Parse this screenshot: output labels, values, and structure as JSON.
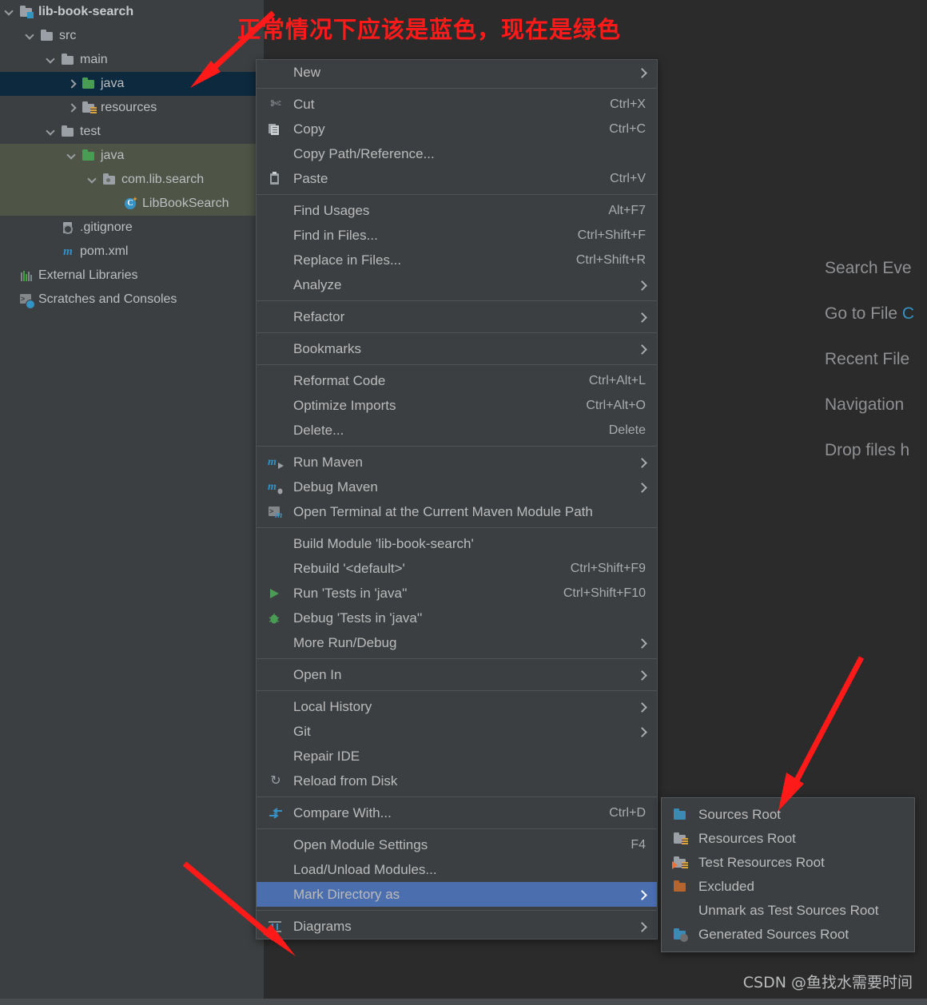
{
  "editor": {
    "hints": [
      {
        "label": "Search Eve",
        "key": ""
      },
      {
        "label": "Go to File",
        "key": "C"
      },
      {
        "label": "Recent File",
        "key": ""
      },
      {
        "label": "Navigation",
        "key": ""
      },
      {
        "label": "Drop files h",
        "key": ""
      }
    ]
  },
  "project_tree": {
    "items": [
      {
        "label": "lib-book-search",
        "indent": 0,
        "arrow": "down",
        "icon": "module-folder-icon",
        "bold": true,
        "state": "none"
      },
      {
        "label": "src",
        "indent": 1,
        "arrow": "down",
        "icon": "folder-gray-icon",
        "bold": false,
        "state": "none"
      },
      {
        "label": "main",
        "indent": 2,
        "arrow": "down",
        "icon": "folder-gray-icon",
        "bold": false,
        "state": "none"
      },
      {
        "label": "java",
        "indent": 3,
        "arrow": "right",
        "icon": "folder-green-icon",
        "bold": false,
        "state": "selected-blue"
      },
      {
        "label": "resources",
        "indent": 3,
        "arrow": "right",
        "icon": "folder-resources-icon",
        "bold": false,
        "state": "none"
      },
      {
        "label": "test",
        "indent": 2,
        "arrow": "down",
        "icon": "folder-gray-icon",
        "bold": false,
        "state": "none"
      },
      {
        "label": "java",
        "indent": 3,
        "arrow": "down",
        "icon": "folder-green-icon",
        "bold": false,
        "state": "selected-green"
      },
      {
        "label": "com.lib.search",
        "indent": 4,
        "arrow": "down",
        "icon": "package-icon",
        "bold": false,
        "state": "selected-green"
      },
      {
        "label": "LibBookSearch",
        "indent": 5,
        "arrow": "none",
        "icon": "java-class-icon",
        "bold": false,
        "state": "selected-green"
      },
      {
        "label": ".gitignore",
        "indent": 2,
        "arrow": "none",
        "icon": "gitignore-file-icon",
        "bold": false,
        "state": "none"
      },
      {
        "label": "pom.xml",
        "indent": 2,
        "arrow": "none",
        "icon": "maven-pom-icon",
        "bold": false,
        "state": "none"
      },
      {
        "label": "External Libraries",
        "indent": 0,
        "arrow": "none",
        "icon": "libraries-icon",
        "bold": false,
        "state": "none"
      },
      {
        "label": "Scratches and Consoles",
        "indent": 0,
        "arrow": "none",
        "icon": "scratches-icon",
        "bold": false,
        "state": "none"
      }
    ]
  },
  "context_menu": {
    "items": [
      {
        "type": "item",
        "label": "New",
        "shortcut": "",
        "icon": "",
        "arrow": true,
        "highlight": false
      },
      {
        "type": "separator"
      },
      {
        "type": "item",
        "label": "Cut",
        "shortcut": "Ctrl+X",
        "icon": "cut-icon",
        "arrow": false,
        "highlight": false
      },
      {
        "type": "item",
        "label": "Copy",
        "shortcut": "Ctrl+C",
        "icon": "copy-icon",
        "arrow": false,
        "highlight": false
      },
      {
        "type": "item",
        "label": "Copy Path/Reference...",
        "shortcut": "",
        "icon": "",
        "arrow": false,
        "highlight": false
      },
      {
        "type": "item",
        "label": "Paste",
        "shortcut": "Ctrl+V",
        "icon": "paste-icon",
        "arrow": false,
        "highlight": false
      },
      {
        "type": "separator"
      },
      {
        "type": "item",
        "label": "Find Usages",
        "shortcut": "Alt+F7",
        "icon": "",
        "arrow": false,
        "highlight": false
      },
      {
        "type": "item",
        "label": "Find in Files...",
        "shortcut": "Ctrl+Shift+F",
        "icon": "",
        "arrow": false,
        "highlight": false
      },
      {
        "type": "item",
        "label": "Replace in Files...",
        "shortcut": "Ctrl+Shift+R",
        "icon": "",
        "arrow": false,
        "highlight": false
      },
      {
        "type": "item",
        "label": "Analyze",
        "shortcut": "",
        "icon": "",
        "arrow": true,
        "highlight": false
      },
      {
        "type": "separator"
      },
      {
        "type": "item",
        "label": "Refactor",
        "shortcut": "",
        "icon": "",
        "arrow": true,
        "highlight": false
      },
      {
        "type": "separator"
      },
      {
        "type": "item",
        "label": "Bookmarks",
        "shortcut": "",
        "icon": "",
        "arrow": true,
        "highlight": false
      },
      {
        "type": "separator"
      },
      {
        "type": "item",
        "label": "Reformat Code",
        "shortcut": "Ctrl+Alt+L",
        "icon": "",
        "arrow": false,
        "highlight": false
      },
      {
        "type": "item",
        "label": "Optimize Imports",
        "shortcut": "Ctrl+Alt+O",
        "icon": "",
        "arrow": false,
        "highlight": false
      },
      {
        "type": "item",
        "label": "Delete...",
        "shortcut": "Delete",
        "icon": "",
        "arrow": false,
        "highlight": false
      },
      {
        "type": "separator"
      },
      {
        "type": "item",
        "label": "Run Maven",
        "shortcut": "",
        "icon": "maven-run-icon",
        "arrow": true,
        "highlight": false
      },
      {
        "type": "item",
        "label": "Debug Maven",
        "shortcut": "",
        "icon": "maven-debug-icon",
        "arrow": true,
        "highlight": false
      },
      {
        "type": "item",
        "label": "Open Terminal at the Current Maven Module Path",
        "shortcut": "",
        "icon": "terminal-maven-icon",
        "arrow": false,
        "highlight": false
      },
      {
        "type": "separator"
      },
      {
        "type": "item",
        "label": "Build Module 'lib-book-search'",
        "shortcut": "",
        "icon": "",
        "arrow": false,
        "highlight": false
      },
      {
        "type": "item",
        "label": "Rebuild '<default>'",
        "shortcut": "Ctrl+Shift+F9",
        "icon": "",
        "arrow": false,
        "highlight": false
      },
      {
        "type": "item",
        "label": "Run 'Tests in 'java''",
        "shortcut": "Ctrl+Shift+F10",
        "icon": "run-icon",
        "arrow": false,
        "highlight": false
      },
      {
        "type": "item",
        "label": "Debug 'Tests in 'java''",
        "shortcut": "",
        "icon": "debug-icon",
        "arrow": false,
        "highlight": false
      },
      {
        "type": "item",
        "label": "More Run/Debug",
        "shortcut": "",
        "icon": "",
        "arrow": true,
        "highlight": false
      },
      {
        "type": "separator"
      },
      {
        "type": "item",
        "label": "Open In",
        "shortcut": "",
        "icon": "",
        "arrow": true,
        "highlight": false
      },
      {
        "type": "separator"
      },
      {
        "type": "item",
        "label": "Local History",
        "shortcut": "",
        "icon": "",
        "arrow": true,
        "highlight": false
      },
      {
        "type": "item",
        "label": "Git",
        "shortcut": "",
        "icon": "",
        "arrow": true,
        "highlight": false
      },
      {
        "type": "item",
        "label": "Repair IDE",
        "shortcut": "",
        "icon": "",
        "arrow": false,
        "highlight": false
      },
      {
        "type": "item",
        "label": "Reload from Disk",
        "shortcut": "",
        "icon": "reload-icon",
        "arrow": false,
        "highlight": false
      },
      {
        "type": "separator"
      },
      {
        "type": "item",
        "label": "Compare With...",
        "shortcut": "Ctrl+D",
        "icon": "compare-icon",
        "arrow": false,
        "highlight": false
      },
      {
        "type": "separator"
      },
      {
        "type": "item",
        "label": "Open Module Settings",
        "shortcut": "F4",
        "icon": "",
        "arrow": false,
        "highlight": false
      },
      {
        "type": "item",
        "label": "Load/Unload Modules...",
        "shortcut": "",
        "icon": "",
        "arrow": false,
        "highlight": false
      },
      {
        "type": "item",
        "label": "Mark Directory as",
        "shortcut": "",
        "icon": "",
        "arrow": true,
        "highlight": true
      },
      {
        "type": "separator"
      },
      {
        "type": "item",
        "label": "Diagrams",
        "shortcut": "",
        "icon": "diagrams-icon",
        "arrow": true,
        "highlight": false
      }
    ]
  },
  "submenu": {
    "items": [
      {
        "label": "Sources Root",
        "icon": "folder-blue-icon"
      },
      {
        "label": "Resources Root",
        "icon": "folder-resources-icon"
      },
      {
        "label": "Test Resources Root",
        "icon": "folder-test-resources-icon"
      },
      {
        "label": "Excluded",
        "icon": "folder-orange-icon"
      },
      {
        "label": "Unmark as Test Sources Root",
        "icon": ""
      },
      {
        "label": "Generated Sources Root",
        "icon": "folder-generated-icon"
      }
    ]
  },
  "annotations": {
    "note_1": "正常情况下应该是蓝色，现在是绿色",
    "arrow_color": "#ff1a1a"
  },
  "watermark": "CSDN @鱼找水需要时间",
  "colors": {
    "background": "#3c3f41",
    "editor_background": "#2b2b2b",
    "selection_blue": "#0d293e",
    "selection_green": "#4e5446",
    "menu_highlight": "#4b6eaf",
    "source_green": "#499c54",
    "source_blue": "#3b8ab5",
    "accent_blue": "#3592c4",
    "annotation_red": "#ff1a1a"
  }
}
